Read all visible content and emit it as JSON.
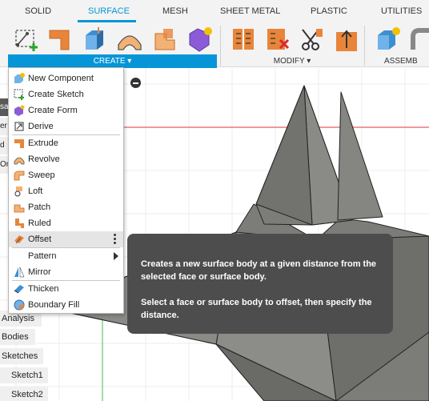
{
  "tabs": [
    {
      "label": "SOLID",
      "active": false
    },
    {
      "label": "SURFACE",
      "active": true
    },
    {
      "label": "MESH",
      "active": false
    },
    {
      "label": "SHEET METAL",
      "active": false
    },
    {
      "label": "PLASTIC",
      "active": false
    },
    {
      "label": "UTILITIES",
      "active": false
    }
  ],
  "toolbar": {
    "create_label": "CREATE ▾",
    "modify_label": "MODIFY ▾",
    "assemble_label": "ASSEMB"
  },
  "browser": {
    "items": [
      "Analysis",
      "Bodies",
      "Sketches",
      "Sketch1",
      "Sketch2"
    ],
    "tabs": [
      "sa",
      "er",
      "d V",
      "Or"
    ]
  },
  "menu": {
    "items": [
      {
        "label": "New Component",
        "icon": "new-component-icon"
      },
      {
        "label": "Create Sketch",
        "icon": "create-sketch-icon"
      },
      {
        "label": "Create Form",
        "icon": "create-form-icon"
      },
      {
        "label": "Derive",
        "icon": "derive-icon"
      },
      {
        "label": "Extrude",
        "icon": "extrude-icon"
      },
      {
        "label": "Revolve",
        "icon": "revolve-icon"
      },
      {
        "label": "Sweep",
        "icon": "sweep-icon"
      },
      {
        "label": "Loft",
        "icon": "loft-icon"
      },
      {
        "label": "Patch",
        "icon": "patch-icon"
      },
      {
        "label": "Ruled",
        "icon": "ruled-icon"
      },
      {
        "label": "Offset",
        "icon": "offset-icon"
      },
      {
        "label": "Pattern",
        "icon": ""
      },
      {
        "label": "Mirror",
        "icon": "mirror-icon"
      },
      {
        "label": "Thicken",
        "icon": "thicken-icon"
      },
      {
        "label": "Boundary Fill",
        "icon": "boundary-fill-icon"
      }
    ]
  },
  "tooltip": {
    "line1": "Creates a new surface body at a given distance from the selected face or surface body.",
    "line2": "Select a face or surface body to offset, then specify the distance."
  },
  "colors": {
    "accent": "#0696d7",
    "tooltip_bg": "#4d4d4d",
    "model_gray": "#7c7c78",
    "axis_red": "#e06060",
    "axis_green": "#70c070"
  }
}
